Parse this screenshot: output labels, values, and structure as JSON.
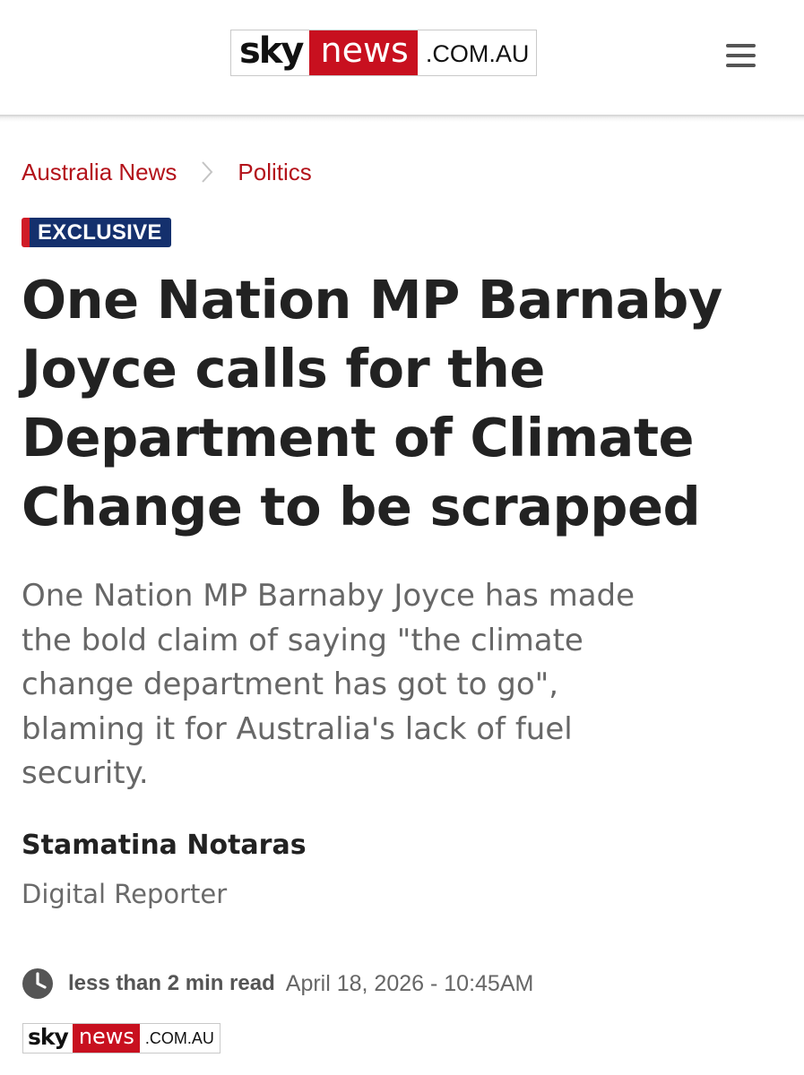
{
  "header": {
    "logo": {
      "sky": "sky",
      "news": "news",
      "domain": ".COM.AU"
    },
    "menu_icon": "hamburger-menu-icon"
  },
  "breadcrumb": {
    "items": [
      "Australia News",
      "Politics"
    ],
    "separator_icon": "chevron-right-icon"
  },
  "article": {
    "badge": "EXCLUSIVE",
    "headline_lines": [
      "One Nation MP Barnaby",
      "Joyce calls for the",
      "Department of Climate",
      "Change to be scrapped"
    ],
    "standfirst_lines": [
      "One Nation MP Barnaby Joyce has made",
      "the bold claim of saying \"the climate",
      "change department has got to go\",",
      "blaming it for Australia's lack of fuel",
      "security."
    ],
    "author": "Stamatina Notaras",
    "author_role": "Digital Reporter",
    "read_time": "less than 2 min read",
    "published": "April 18, 2026 - 10:45AM",
    "clock_icon": "clock-icon"
  },
  "footer_logo": {
    "sky": "sky",
    "news": "news",
    "domain": ".COM.AU"
  },
  "colors": {
    "brand_red": "#c8101f",
    "link_red": "#b3121a",
    "badge_navy": "#14306d",
    "headline": "#222222",
    "standfirst": "#676767"
  }
}
